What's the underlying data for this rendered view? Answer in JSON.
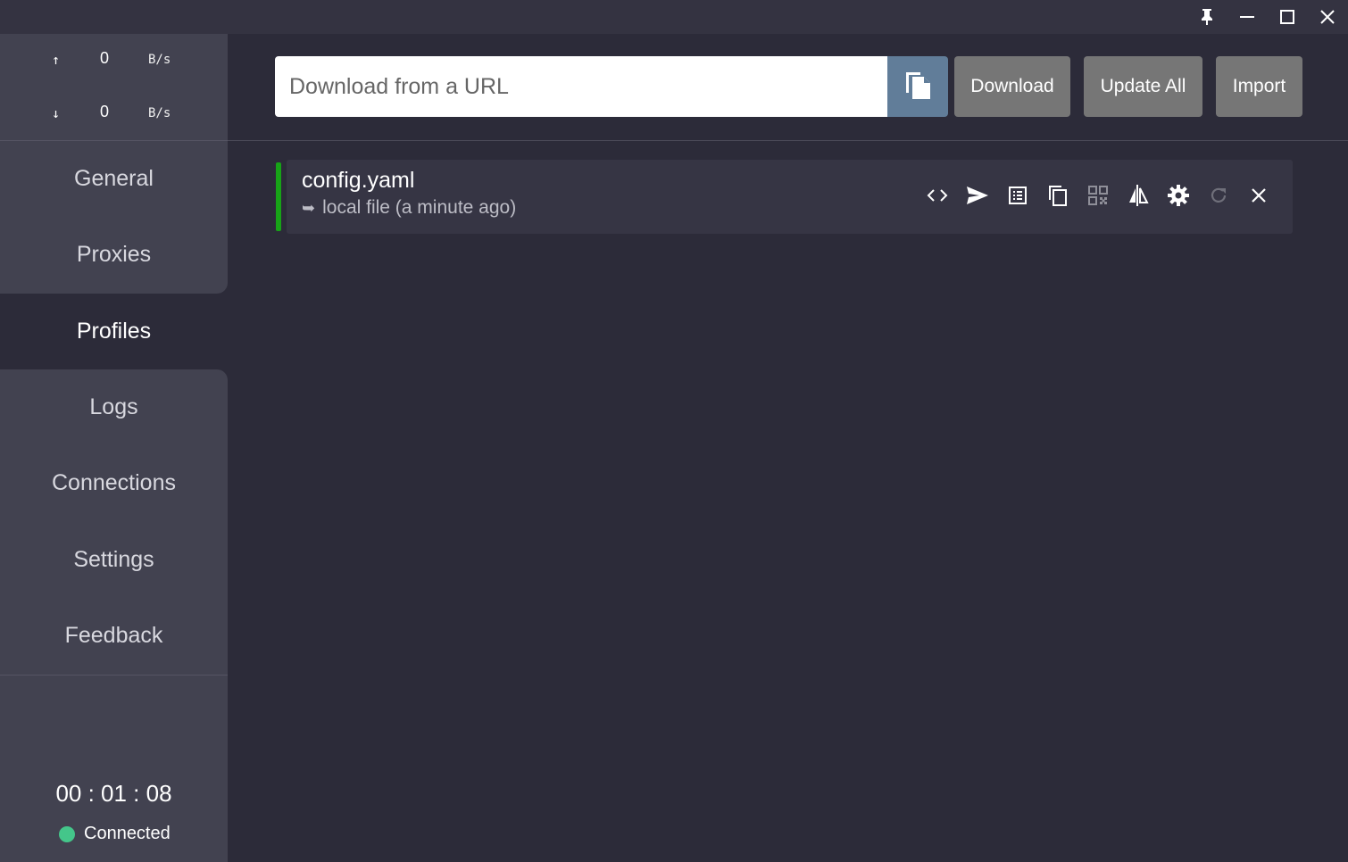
{
  "window": {
    "controls": [
      "pin-icon",
      "minimize-icon",
      "maximize-icon",
      "close-icon"
    ]
  },
  "traffic": {
    "up": {
      "arrow": "↑",
      "value": "0",
      "unit": "B/s"
    },
    "down": {
      "arrow": "↓",
      "value": "0",
      "unit": "B/s"
    }
  },
  "sidebar": {
    "items": [
      {
        "label": "General"
      },
      {
        "label": "Proxies"
      },
      {
        "label": "Profiles"
      },
      {
        "label": "Logs"
      },
      {
        "label": "Connections"
      },
      {
        "label": "Settings"
      },
      {
        "label": "Feedback"
      }
    ],
    "active": "Profiles",
    "timer": "00 : 01 : 08",
    "status": "Connected",
    "status_color": "#44c68a"
  },
  "toolbar": {
    "url_placeholder": "Download from a URL",
    "paste_icon": "paste-icon",
    "download_label": "Download",
    "update_all_label": "Update All",
    "import_label": "Import"
  },
  "profiles": [
    {
      "name": "config.yaml",
      "source_arrow": "➥",
      "source": "local file (a minute ago)",
      "selected_color": "#17a317",
      "actions": [
        "code-icon",
        "send-icon",
        "list-icon",
        "copy-icon",
        "qr-code-icon",
        "compare-icon",
        "gear-icon",
        "refresh-icon",
        "close-icon"
      ]
    }
  ]
}
